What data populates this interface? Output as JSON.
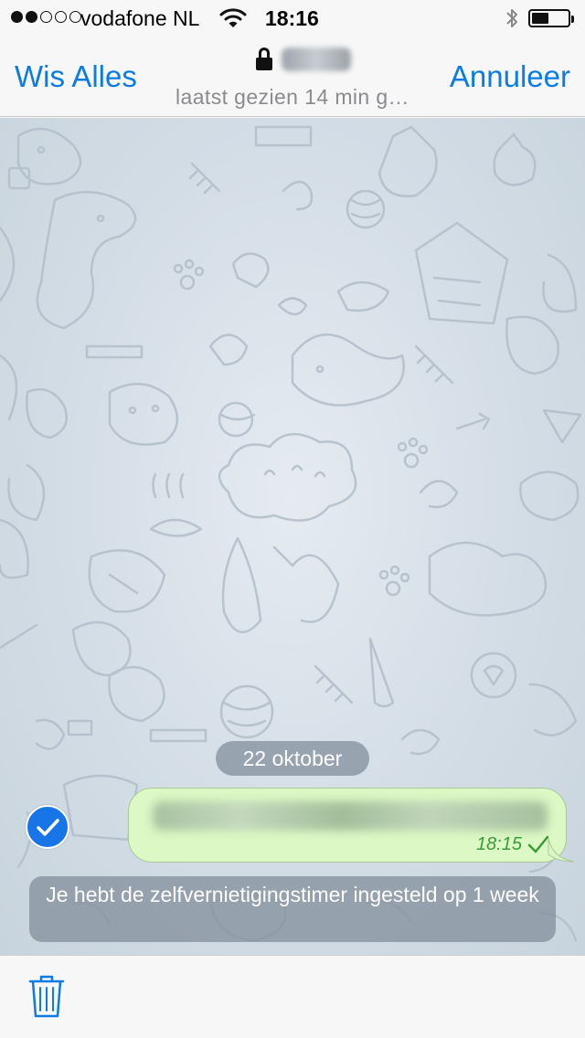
{
  "status_bar": {
    "signal_dots_filled": 2,
    "signal_dots_total": 5,
    "carrier": "vodafone NL",
    "wifi_icon": "wifi-icon",
    "time": "18:16",
    "bluetooth_icon": "bluetooth-icon",
    "battery_icon": "battery-icon",
    "battery_level": 0.4
  },
  "nav_bar": {
    "left_button": "Wis Alles",
    "right_button": "Annuleer",
    "lock_icon": "lock-icon",
    "subtitle": "laatst gezien 14 min g…"
  },
  "chat": {
    "date_label": "22 oktober",
    "messages": [
      {
        "selected": true,
        "time": "18:15",
        "status_icon": "checkmark-icon"
      }
    ],
    "service_message": "Je hebt de zelfvernietigingstimer ingesteld op 1 week"
  },
  "toolbar": {
    "delete_icon": "trash-icon"
  },
  "colors": {
    "accent": "#0c7ce3",
    "bubble_out": "#dcf8c4",
    "time_green": "#3a9c38",
    "pill_bg": "#8c98a5",
    "wallpaper": "#d3dde6"
  }
}
